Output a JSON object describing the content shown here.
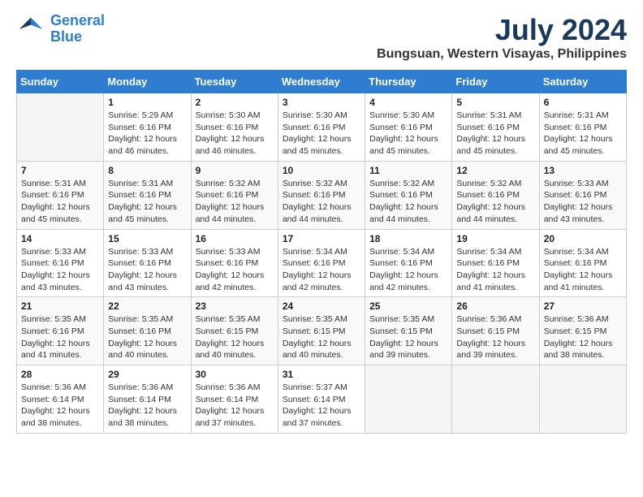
{
  "logo": {
    "line1": "General",
    "line2": "Blue"
  },
  "title": {
    "month_year": "July 2024",
    "location": "Bungsuan, Western Visayas, Philippines"
  },
  "headers": [
    "Sunday",
    "Monday",
    "Tuesday",
    "Wednesday",
    "Thursday",
    "Friday",
    "Saturday"
  ],
  "weeks": [
    [
      {
        "day": "",
        "info": ""
      },
      {
        "day": "1",
        "info": "Sunrise: 5:29 AM\nSunset: 6:16 PM\nDaylight: 12 hours\nand 46 minutes."
      },
      {
        "day": "2",
        "info": "Sunrise: 5:30 AM\nSunset: 6:16 PM\nDaylight: 12 hours\nand 46 minutes."
      },
      {
        "day": "3",
        "info": "Sunrise: 5:30 AM\nSunset: 6:16 PM\nDaylight: 12 hours\nand 45 minutes."
      },
      {
        "day": "4",
        "info": "Sunrise: 5:30 AM\nSunset: 6:16 PM\nDaylight: 12 hours\nand 45 minutes."
      },
      {
        "day": "5",
        "info": "Sunrise: 5:31 AM\nSunset: 6:16 PM\nDaylight: 12 hours\nand 45 minutes."
      },
      {
        "day": "6",
        "info": "Sunrise: 5:31 AM\nSunset: 6:16 PM\nDaylight: 12 hours\nand 45 minutes."
      }
    ],
    [
      {
        "day": "7",
        "info": "Sunrise: 5:31 AM\nSunset: 6:16 PM\nDaylight: 12 hours\nand 45 minutes."
      },
      {
        "day": "8",
        "info": "Sunrise: 5:31 AM\nSunset: 6:16 PM\nDaylight: 12 hours\nand 45 minutes."
      },
      {
        "day": "9",
        "info": "Sunrise: 5:32 AM\nSunset: 6:16 PM\nDaylight: 12 hours\nand 44 minutes."
      },
      {
        "day": "10",
        "info": "Sunrise: 5:32 AM\nSunset: 6:16 PM\nDaylight: 12 hours\nand 44 minutes."
      },
      {
        "day": "11",
        "info": "Sunrise: 5:32 AM\nSunset: 6:16 PM\nDaylight: 12 hours\nand 44 minutes."
      },
      {
        "day": "12",
        "info": "Sunrise: 5:32 AM\nSunset: 6:16 PM\nDaylight: 12 hours\nand 44 minutes."
      },
      {
        "day": "13",
        "info": "Sunrise: 5:33 AM\nSunset: 6:16 PM\nDaylight: 12 hours\nand 43 minutes."
      }
    ],
    [
      {
        "day": "14",
        "info": "Sunrise: 5:33 AM\nSunset: 6:16 PM\nDaylight: 12 hours\nand 43 minutes."
      },
      {
        "day": "15",
        "info": "Sunrise: 5:33 AM\nSunset: 6:16 PM\nDaylight: 12 hours\nand 43 minutes."
      },
      {
        "day": "16",
        "info": "Sunrise: 5:33 AM\nSunset: 6:16 PM\nDaylight: 12 hours\nand 42 minutes."
      },
      {
        "day": "17",
        "info": "Sunrise: 5:34 AM\nSunset: 6:16 PM\nDaylight: 12 hours\nand 42 minutes."
      },
      {
        "day": "18",
        "info": "Sunrise: 5:34 AM\nSunset: 6:16 PM\nDaylight: 12 hours\nand 42 minutes."
      },
      {
        "day": "19",
        "info": "Sunrise: 5:34 AM\nSunset: 6:16 PM\nDaylight: 12 hours\nand 41 minutes."
      },
      {
        "day": "20",
        "info": "Sunrise: 5:34 AM\nSunset: 6:16 PM\nDaylight: 12 hours\nand 41 minutes."
      }
    ],
    [
      {
        "day": "21",
        "info": "Sunrise: 5:35 AM\nSunset: 6:16 PM\nDaylight: 12 hours\nand 41 minutes."
      },
      {
        "day": "22",
        "info": "Sunrise: 5:35 AM\nSunset: 6:16 PM\nDaylight: 12 hours\nand 40 minutes."
      },
      {
        "day": "23",
        "info": "Sunrise: 5:35 AM\nSunset: 6:15 PM\nDaylight: 12 hours\nand 40 minutes."
      },
      {
        "day": "24",
        "info": "Sunrise: 5:35 AM\nSunset: 6:15 PM\nDaylight: 12 hours\nand 40 minutes."
      },
      {
        "day": "25",
        "info": "Sunrise: 5:35 AM\nSunset: 6:15 PM\nDaylight: 12 hours\nand 39 minutes."
      },
      {
        "day": "26",
        "info": "Sunrise: 5:36 AM\nSunset: 6:15 PM\nDaylight: 12 hours\nand 39 minutes."
      },
      {
        "day": "27",
        "info": "Sunrise: 5:36 AM\nSunset: 6:15 PM\nDaylight: 12 hours\nand 38 minutes."
      }
    ],
    [
      {
        "day": "28",
        "info": "Sunrise: 5:36 AM\nSunset: 6:14 PM\nDaylight: 12 hours\nand 38 minutes."
      },
      {
        "day": "29",
        "info": "Sunrise: 5:36 AM\nSunset: 6:14 PM\nDaylight: 12 hours\nand 38 minutes."
      },
      {
        "day": "30",
        "info": "Sunrise: 5:36 AM\nSunset: 6:14 PM\nDaylight: 12 hours\nand 37 minutes."
      },
      {
        "day": "31",
        "info": "Sunrise: 5:37 AM\nSunset: 6:14 PM\nDaylight: 12 hours\nand 37 minutes."
      },
      {
        "day": "",
        "info": ""
      },
      {
        "day": "",
        "info": ""
      },
      {
        "day": "",
        "info": ""
      }
    ]
  ]
}
